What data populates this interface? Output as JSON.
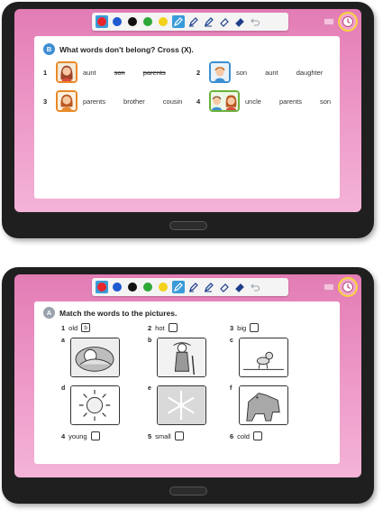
{
  "toolbar": {
    "colors": [
      "#e8262b",
      "#1f5ad1",
      "#111111",
      "#2ea838",
      "#f2d21b"
    ],
    "tools": [
      "pen-icon",
      "highlighter-icon",
      "marker-icon",
      "eraser-icon",
      "clear-eraser-icon",
      "undo-icon"
    ]
  },
  "exercise_b": {
    "badge": "B",
    "instruction": "What words don't belong? Cross (X).",
    "items": [
      {
        "num": "1",
        "words": [
          {
            "text": "aunt",
            "crossed": false
          },
          {
            "text": "son",
            "crossed": true
          },
          {
            "text": "parents",
            "crossed": true
          }
        ]
      },
      {
        "num": "2",
        "words": [
          {
            "text": "son",
            "crossed": false
          },
          {
            "text": "aunt",
            "crossed": false
          },
          {
            "text": "daughter",
            "crossed": false
          }
        ]
      },
      {
        "num": "3",
        "words": [
          {
            "text": "parents",
            "crossed": false
          },
          {
            "text": "brother",
            "crossed": false
          },
          {
            "text": "cousin",
            "crossed": false
          }
        ]
      },
      {
        "num": "4",
        "words": [
          {
            "text": "uncle",
            "crossed": false
          },
          {
            "text": "parents",
            "crossed": false
          },
          {
            "text": "son",
            "crossed": false
          }
        ]
      }
    ]
  },
  "exercise_a": {
    "badge": "A",
    "instruction": "Match the words to the pictures.",
    "words": [
      {
        "num": "1",
        "word": "old",
        "answer": "b"
      },
      {
        "num": "2",
        "word": "hot",
        "answer": ""
      },
      {
        "num": "3",
        "word": "big",
        "answer": ""
      },
      {
        "num": "4",
        "word": "young",
        "answer": ""
      },
      {
        "num": "5",
        "word": "small",
        "answer": ""
      },
      {
        "num": "6",
        "word": "cold",
        "answer": ""
      }
    ],
    "pictures": [
      "a",
      "b",
      "c",
      "d",
      "e",
      "f"
    ]
  }
}
